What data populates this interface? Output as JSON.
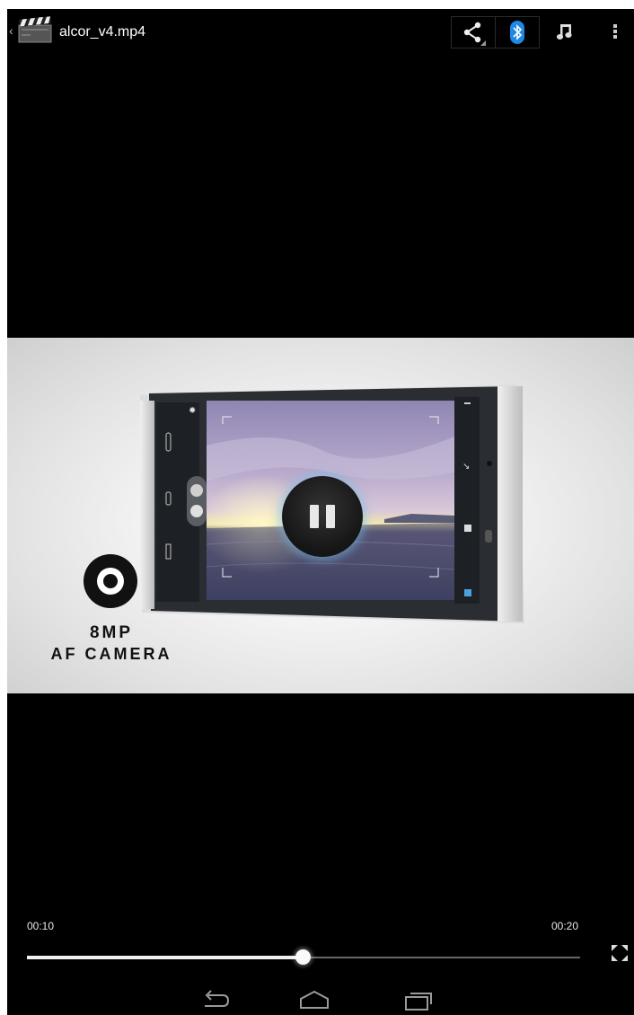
{
  "action_bar": {
    "title": "alcor_v4.mp4",
    "up_icon": "chevron-left-icon",
    "app_icon": "clapperboard-icon",
    "actions": [
      {
        "name": "share",
        "icon": "share-icon"
      },
      {
        "name": "bluetooth",
        "icon": "bluetooth-icon"
      },
      {
        "name": "music",
        "icon": "music-note-icon"
      },
      {
        "name": "overflow",
        "icon": "more-vert-icon"
      }
    ]
  },
  "video": {
    "overlay_badge": {
      "line1": "8MP",
      "line2": "AF CAMERA",
      "icon": "camera-shutter-icon"
    },
    "center_control": "pause-icon"
  },
  "playback": {
    "current_time": "00:10",
    "total_time": "00:20",
    "progress": 0.5,
    "fullscreen_icon": "fullscreen-icon"
  },
  "nav_bar": {
    "buttons": [
      {
        "name": "back",
        "icon": "back-arrow-icon"
      },
      {
        "name": "home",
        "icon": "home-icon"
      },
      {
        "name": "recents",
        "icon": "recent-apps-icon"
      }
    ]
  },
  "colors": {
    "background": "#000000",
    "bluetooth_accent": "#1e88e5",
    "seek_fill": "#f0f0f0",
    "seek_track": "#666666"
  }
}
